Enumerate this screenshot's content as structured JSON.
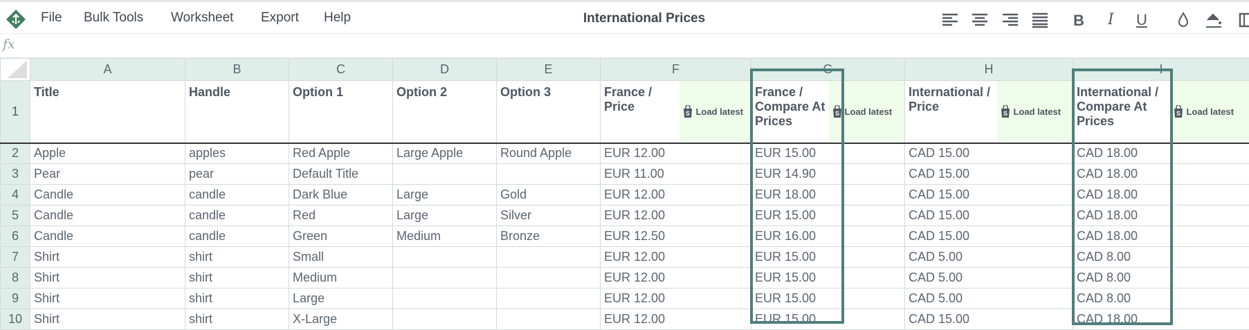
{
  "menubar": {
    "items": [
      "File",
      "Bulk Tools",
      "Worksheet",
      "Export",
      "Help"
    ],
    "title": "International Prices"
  },
  "toolbar": {
    "icons": [
      "align-left-icon",
      "align-center-icon",
      "align-right-icon",
      "align-justify-icon",
      "bold-icon",
      "italic-icon",
      "underline-icon",
      "text-color-icon",
      "fill-color-icon",
      "border-icon"
    ],
    "bold": "B",
    "italic": "I",
    "underline": "U"
  },
  "formula_bar": {
    "label": "fx",
    "value": ""
  },
  "columns": [
    "A",
    "B",
    "C",
    "D",
    "E",
    "F",
    "G",
    "H",
    "I"
  ],
  "headers": {
    "A": "Title",
    "B": "Handle",
    "C": "Option 1",
    "D": "Option 2",
    "E": "Option 3",
    "F": "France / Price",
    "G": "France / Compare At Prices",
    "H": "International / Price",
    "I": "International / Compare At Prices",
    "load_label": "Load latest"
  },
  "rows": [
    {
      "n": "2",
      "cells": [
        "Apple",
        "apples",
        "Red Apple",
        "Large Apple",
        "Round Apple",
        "EUR 12.00",
        "EUR 15.00",
        "CAD 15.00",
        "CAD 18.00"
      ]
    },
    {
      "n": "3",
      "cells": [
        "Pear",
        "pear",
        "Default Title",
        "",
        "",
        "EUR 11.00",
        "EUR 14.90",
        "CAD 15.00",
        "CAD 18.00"
      ]
    },
    {
      "n": "4",
      "cells": [
        "Candle",
        "candle",
        "Dark Blue",
        "Large",
        "Gold",
        "EUR 12.00",
        "EUR 18.00",
        "CAD 15.00",
        "CAD 18.00"
      ]
    },
    {
      "n": "5",
      "cells": [
        "Candle",
        "candle",
        "Red",
        "Large",
        "Silver",
        "EUR 12.00",
        "EUR 15.00",
        "CAD 15.00",
        "CAD 18.00"
      ]
    },
    {
      "n": "6",
      "cells": [
        "Candle",
        "candle",
        "Green",
        "Medium",
        "Bronze",
        "EUR 12.50",
        "EUR 16.00",
        "CAD 15.00",
        "CAD 18.00"
      ]
    },
    {
      "n": "7",
      "cells": [
        "Shirt",
        "shirt",
        "Small",
        "",
        "",
        "EUR 12.00",
        "EUR 15.00",
        "CAD 5.00",
        "CAD 8.00"
      ]
    },
    {
      "n": "8",
      "cells": [
        "Shirt",
        "shirt",
        "Medium",
        "",
        "",
        "EUR 12.00",
        "EUR 15.00",
        "CAD 5.00",
        "CAD 8.00"
      ]
    },
    {
      "n": "9",
      "cells": [
        "Shirt",
        "shirt",
        "Large",
        "",
        "",
        "EUR 12.00",
        "EUR 15.00",
        "CAD 5.00",
        "CAD 8.00"
      ]
    },
    {
      "n": "10",
      "cells": [
        "Shirt",
        "shirt",
        "X-Large",
        "",
        "",
        "EUR 12.00",
        "EUR 15.00",
        "CAD 15.00",
        "CAD 18.00"
      ]
    }
  ],
  "colors": {
    "accent": "#3f7f5f",
    "highlight": "#4f7f7d",
    "header_bg": "#dfeee8",
    "load_bg": "#effcea"
  }
}
